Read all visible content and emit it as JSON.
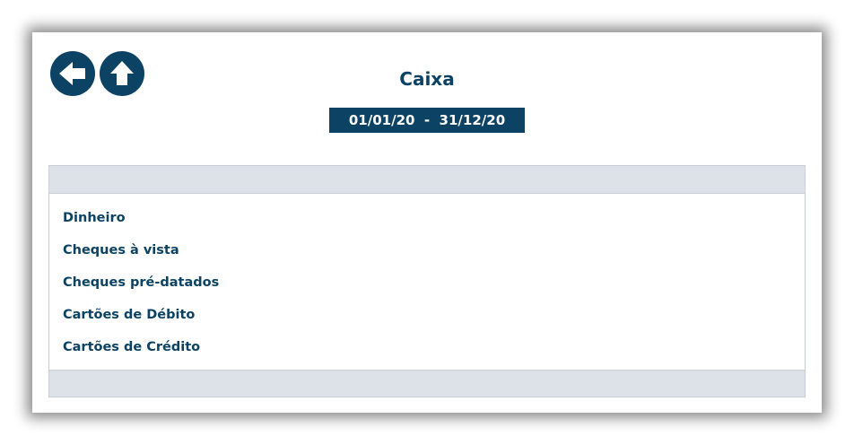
{
  "header": {
    "title": "Caixa",
    "date_range": "01/01/20  -  31/12/20"
  },
  "nav": {
    "back_icon": "arrow-left-icon",
    "home_icon": "arrow-up-icon"
  },
  "colors": {
    "primary": "#0c4264",
    "panel_bar": "#dde1e8"
  },
  "list": {
    "items": [
      {
        "label": "Dinheiro"
      },
      {
        "label": "Cheques à vista"
      },
      {
        "label": "Cheques pré-datados"
      },
      {
        "label": "Cartões de Débito"
      },
      {
        "label": "Cartões de Crédito"
      }
    ]
  }
}
